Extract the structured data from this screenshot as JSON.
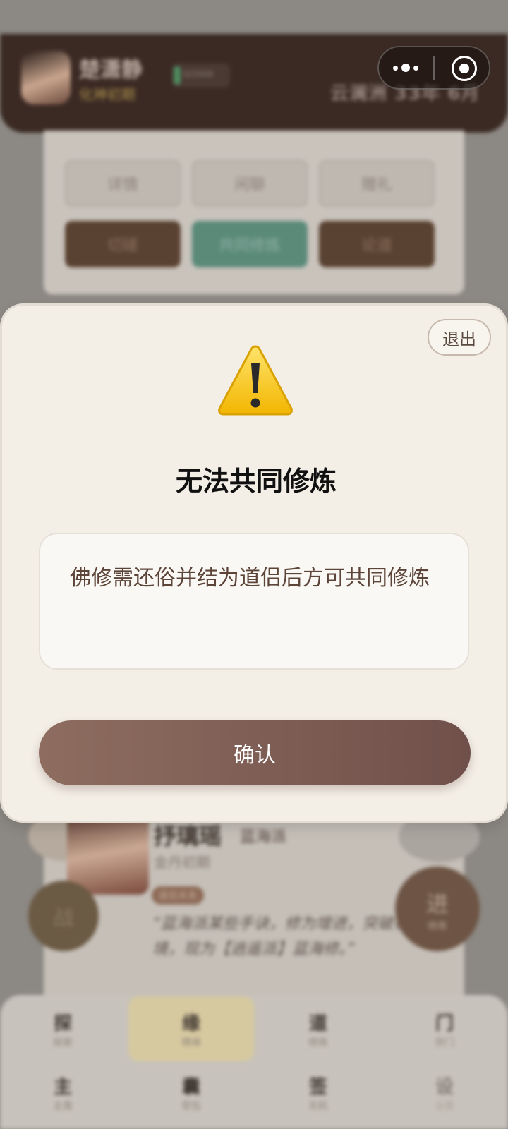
{
  "background": {
    "header": {
      "player_name": "楚潇静",
      "player_rank": "化神初期",
      "energy_text": "0/2000",
      "location": "云澜洲 33年 6月"
    },
    "action_buttons": [
      {
        "label": "详情"
      },
      {
        "label": "闲聊"
      },
      {
        "label": "赠礼"
      },
      {
        "label": "切磋"
      },
      {
        "label": "共同修炼"
      },
      {
        "label": "论道"
      }
    ],
    "profile": {
      "name": "抒璃瑶",
      "sect": "蓝海派",
      "rank": "金丹初期",
      "tag": "道侣关系",
      "quote": "“蓝海派某些手诀，修为增进，突破初期境，现为【逍遥派】蓝海修。”"
    },
    "left_circle_label": "战",
    "right_circle_label": "进",
    "right_circle_sub": "修炼",
    "tabs_row1": [
      {
        "label": "探",
        "sub": "探索"
      },
      {
        "label": "缘",
        "sub": "情缘"
      },
      {
        "label": "道",
        "sub": "修炼"
      },
      {
        "label": "门",
        "sub": "宗门"
      }
    ],
    "tabs_row2": [
      {
        "label": "主",
        "sub": "主角"
      },
      {
        "label": "囊",
        "sub": "背包"
      },
      {
        "label": "签",
        "sub": "天机"
      },
      {
        "label": "设",
        "sub": "设置"
      }
    ]
  },
  "modal": {
    "exit_label": "退出",
    "icon": "warning-icon",
    "title": "无法共同修炼",
    "message": "佛修需还俗并结为道侣后方可共同修炼",
    "confirm_label": "确认"
  },
  "colors": {
    "modal_bg": "#f3eee6",
    "confirm_bg": "#7f5e55",
    "header_bg": "#3b2a24",
    "warning_yellow": "#f5c518"
  }
}
